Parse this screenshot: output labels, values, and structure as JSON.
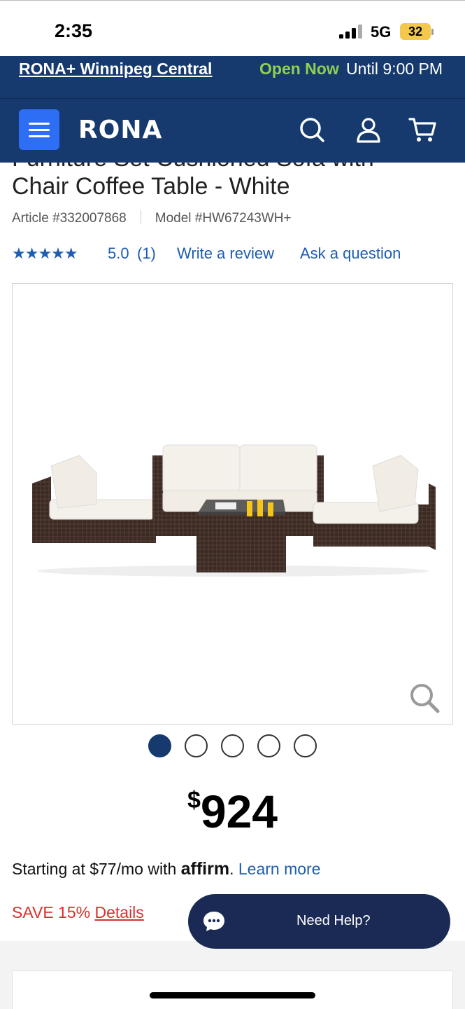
{
  "status_bar": {
    "time": "2:35",
    "network": "5G",
    "battery": "32"
  },
  "store_bar": {
    "store_name": "RONA+ Winnipeg Central",
    "open_status": "Open Now",
    "hours": "Until 9:00 PM"
  },
  "nav": {
    "logo": "RONA",
    "icons": [
      "menu-icon",
      "search-icon",
      "account-icon",
      "cart-icon"
    ]
  },
  "product": {
    "title_line1": "Furniture Set Cushioned Sofa with",
    "title_line2": "Chair Coffee Table - White",
    "article": "Article #332007868",
    "model": "Model #HW67243WH+",
    "stars": "★★★★★",
    "rating": "5.0",
    "review_count": "(1)",
    "write_review": "Write a review",
    "ask_question": "Ask a question",
    "image_count": 5,
    "active_image": 1,
    "price_currency": "$",
    "price_amount": "924",
    "financing_text": "Starting at $77/mo with ",
    "financing_brand": "affirm",
    "financing_period": ".",
    "learn_more": "Learn more",
    "save_text": "SAVE 15% ",
    "details": "Details"
  },
  "help": {
    "label": "Need Help?"
  },
  "colors": {
    "navy": "#163a6e",
    "accent_blue": "#2d6ef5",
    "link_blue": "#1e5db0",
    "sale_red": "#d9302c",
    "open_green": "#8fd14f"
  }
}
